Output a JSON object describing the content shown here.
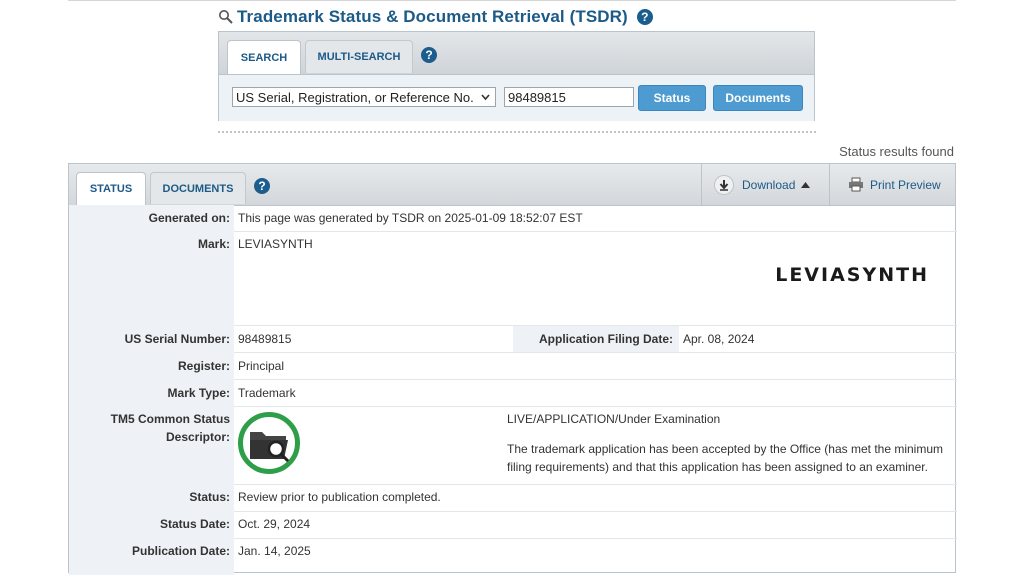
{
  "header": {
    "title": "Trademark Status & Document Retrieval (TSDR)"
  },
  "search": {
    "tabs": [
      "SEARCH",
      "MULTI-SEARCH"
    ],
    "select_value": "US Serial, Registration, or Reference No.",
    "input_value": "98489815",
    "status_button": "Status",
    "documents_button": "Documents"
  },
  "results_found": "Status results found",
  "results": {
    "tabs": [
      "STATUS",
      "DOCUMENTS"
    ],
    "download_label": "Download",
    "print_label": "Print Preview",
    "fields": {
      "generated_on_label": "Generated on:",
      "generated_on_value": "This page was generated by TSDR on 2025-01-09 18:52:07 EST",
      "mark_label": "Mark:",
      "mark_value": "LEVIASYNTH",
      "mark_image_text": "LEVIASYNTH",
      "serial_label": "US Serial Number:",
      "serial_value": "98489815",
      "filing_date_label": "Application Filing Date:",
      "filing_date_value": "Apr. 08, 2024",
      "register_label": "Register:",
      "register_value": "Principal",
      "mark_type_label": "Mark Type:",
      "mark_type_value": "Trademark",
      "tm5_label_line1": "TM5 Common Status",
      "tm5_label_line2": "Descriptor:",
      "tm5_status": "LIVE/APPLICATION/Under Examination",
      "tm5_description": "The trademark application has been accepted by the Office (has met the minimum filing requirements) and that this application has been assigned to an examiner.",
      "status_label": "Status:",
      "status_value": "Review prior to publication completed.",
      "status_date_label": "Status Date:",
      "status_date_value": "Oct. 29, 2024",
      "publication_date_label": "Publication Date:",
      "publication_date_value": "Jan. 14, 2025"
    }
  },
  "icons": {
    "header": "search-icon",
    "help": "help-icon",
    "download": "download-icon",
    "print": "printer-icon",
    "tm5": "folder-search-icon"
  },
  "colors": {
    "accent": "#1c5a87",
    "button": "#4d9bd0",
    "tm5_ring": "#2f9e48"
  }
}
